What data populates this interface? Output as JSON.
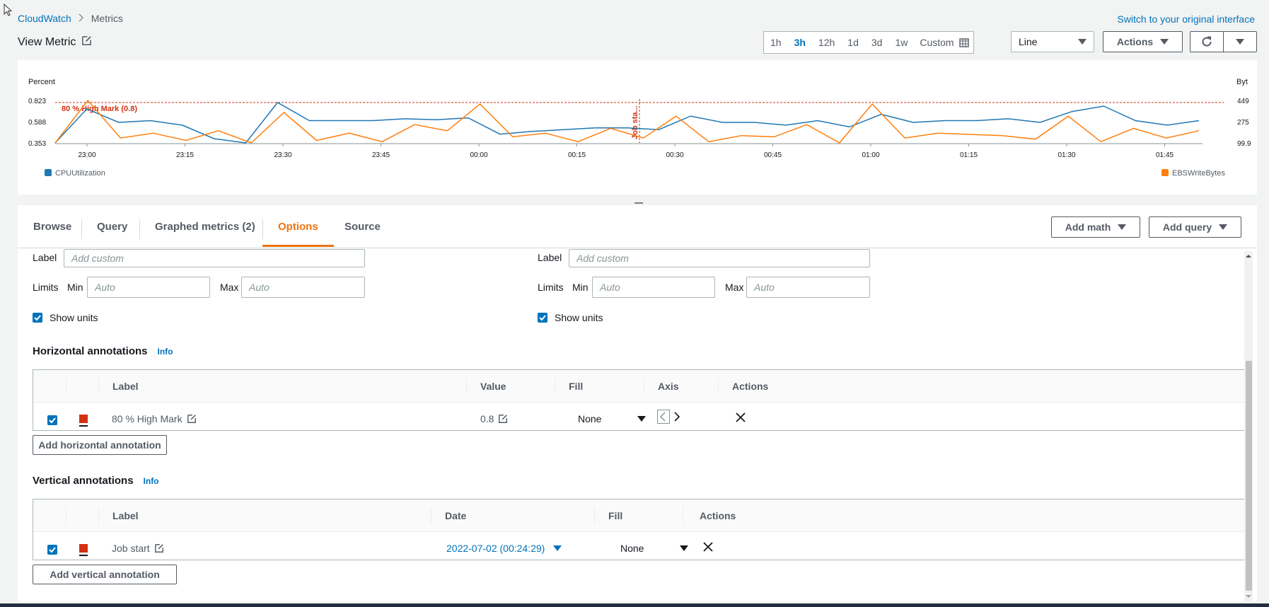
{
  "header": {
    "breadcrumb": [
      "CloudWatch",
      "Metrics"
    ],
    "switch_link": "Switch to your original interface",
    "title": "View Metric"
  },
  "toolbar": {
    "time_ranges": [
      "1h",
      "3h",
      "12h",
      "1d",
      "3d",
      "1w"
    ],
    "active_range": "3h",
    "custom_label": "Custom",
    "graph_type": "Line",
    "actions_label": "Actions"
  },
  "chart_data": {
    "type": "line",
    "left_axis": {
      "label": "Percent",
      "ticks": [
        "0.823",
        "0.588",
        "0.353"
      ],
      "ylim": [
        0.353,
        0.823
      ]
    },
    "right_axis": {
      "label": "Byt",
      "ticks": [
        "449",
        "275",
        "99.9"
      ],
      "ylim": [
        99.9,
        449
      ]
    },
    "x_ticks": [
      "23:00",
      "23:15",
      "23:30",
      "23:45",
      "00:00",
      "00:15",
      "00:30",
      "00:45",
      "01:00",
      "01:15",
      "01:30",
      "01:45"
    ],
    "x_minutes": [
      0,
      5,
      10,
      15,
      20,
      25,
      30,
      35,
      40,
      45,
      50,
      55,
      60,
      65,
      70,
      75,
      80,
      85,
      90,
      95,
      100,
      105,
      110,
      115,
      120,
      125,
      130,
      135,
      140,
      145,
      150,
      155,
      160,
      165
    ],
    "series": [
      {
        "name": "CPUUtilization",
        "color": "#1f77b4",
        "axis": "left",
        "values": [
          0.353,
          0.73,
          0.58,
          0.6,
          0.55,
          0.4,
          0.353,
          0.8,
          0.6,
          0.6,
          0.6,
          0.62,
          0.61,
          0.63,
          0.45,
          0.48,
          0.5,
          0.52,
          0.52,
          0.5,
          0.65,
          0.58,
          0.58,
          0.55,
          0.6,
          0.53,
          0.67,
          0.58,
          0.6,
          0.6,
          0.62,
          0.58,
          0.7,
          0.76,
          0.6,
          0.55,
          0.6
        ]
      },
      {
        "name": "EBSWriteBytes",
        "color": "#ff7f0e",
        "axis": "right",
        "values": [
          99.9,
          449,
          140,
          180,
          120,
          200,
          99.9,
          350,
          120,
          180,
          110,
          250,
          200,
          420,
          150,
          180,
          110,
          220,
          140,
          320,
          110,
          160,
          150,
          250,
          100,
          420,
          140,
          180,
          170,
          160,
          130,
          320,
          110,
          220,
          140,
          200
        ]
      }
    ],
    "annotations": {
      "horizontal": {
        "label": "80 % High Mark (0.8)",
        "value": 0.8,
        "color": "#d13212"
      },
      "vertical": {
        "label": "Job sta...",
        "time": "00:24:29",
        "color": "#d13212"
      }
    },
    "legend_placement": "bottom"
  },
  "tabs": [
    "Browse",
    "Query",
    "Graphed metrics (2)",
    "Options",
    "Source"
  ],
  "active_tab": "Options",
  "tab_actions": {
    "add_math": "Add math",
    "add_query": "Add query"
  },
  "left_axis_opts": {
    "label": "Label",
    "label_placeholder": "Add custom",
    "limits": "Limits",
    "min": "Min",
    "min_placeholder": "Auto",
    "max": "Max",
    "max_placeholder": "Auto",
    "show_units": "Show units"
  },
  "right_axis_opts": {
    "label": "Label",
    "label_placeholder": "Add custom",
    "limits": "Limits",
    "min": "Min",
    "min_placeholder": "Auto",
    "max": "Max",
    "max_placeholder": "Auto",
    "show_units": "Show units"
  },
  "horizontal_annotations": {
    "title": "Horizontal annotations",
    "info": "Info",
    "columns": [
      "Label",
      "Value",
      "Fill",
      "Axis",
      "Actions"
    ],
    "row": {
      "label": "80 % High Mark",
      "value": "0.8",
      "fill": "None"
    },
    "add_button": "Add horizontal annotation"
  },
  "vertical_annotations": {
    "title": "Vertical annotations",
    "info": "Info",
    "columns": [
      "Label",
      "Date",
      "Fill",
      "Actions"
    ],
    "row": {
      "label": "Job start",
      "date": "2022-07-02 (00:24:29)",
      "fill": "None"
    },
    "add_button": "Add vertical annotation"
  }
}
